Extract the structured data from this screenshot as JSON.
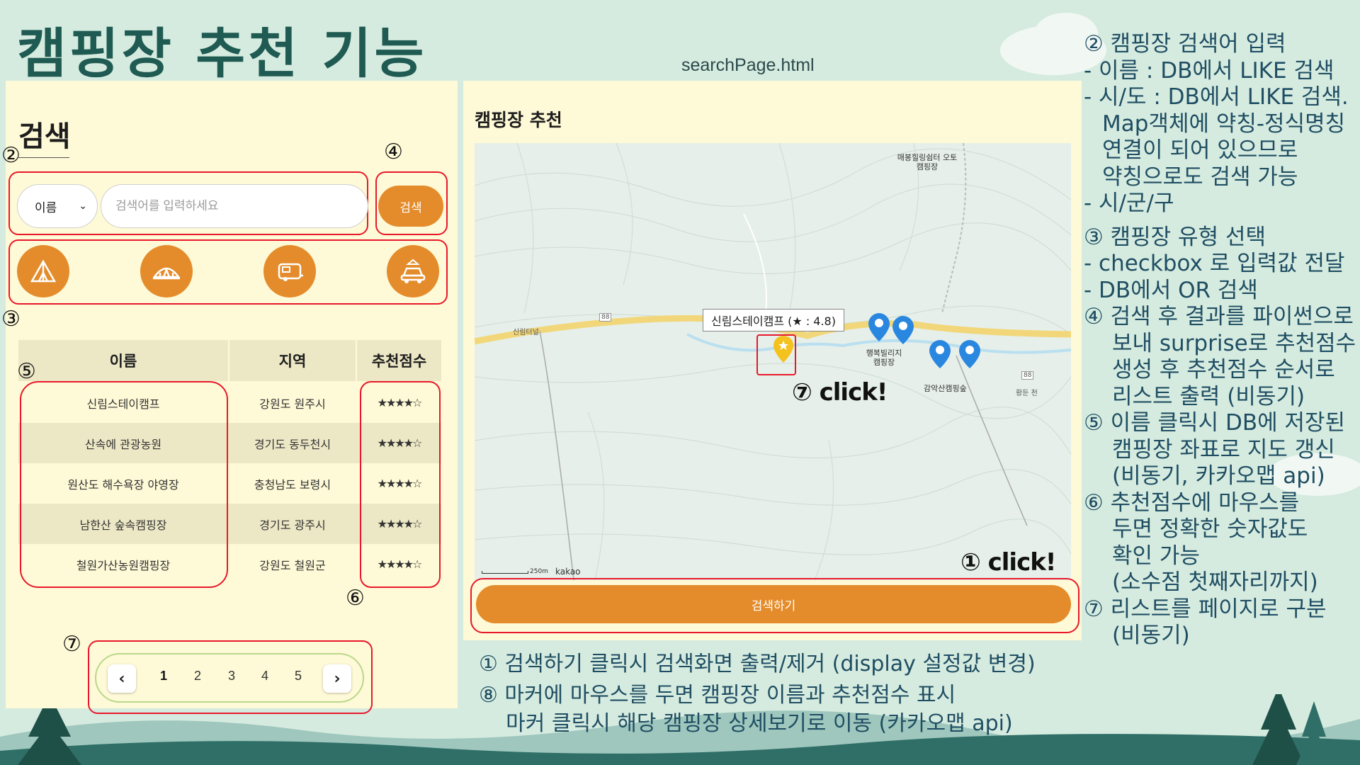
{
  "slide": {
    "title": "캠핑장 추천 기능",
    "file_name": "searchPage.html"
  },
  "search_panel": {
    "heading": "검색",
    "select_value": "이름",
    "input_placeholder": "검색어를 입력하세요",
    "search_button": "검색",
    "type_icons": [
      "tent-icon",
      "glamping-icon",
      "caravan-icon",
      "car-camping-icon"
    ],
    "table": {
      "headers": [
        "이름",
        "지역",
        "추천점수"
      ],
      "rows": [
        {
          "name": "신림스테이캠프",
          "region": "강원도 원주시",
          "stars": "★★★★☆"
        },
        {
          "name": "산속에 관광농원",
          "region": "경기도 동두천시",
          "stars": "★★★★☆"
        },
        {
          "name": "원산도 해수욕장 야영장",
          "region": "충청남도 보령시",
          "stars": "★★★★☆"
        },
        {
          "name": "남한산 숲속캠핑장",
          "region": "경기도 광주시",
          "stars": "★★★★☆"
        },
        {
          "name": "철원가산농원캠핑장",
          "region": "강원도 철원군",
          "stars": "★★★★☆"
        }
      ]
    },
    "pagination": {
      "prev": "‹",
      "next": "›",
      "pages": [
        "1",
        "2",
        "3",
        "4",
        "5"
      ],
      "current": "1"
    }
  },
  "recommend_panel": {
    "title": "캠핑장 추천",
    "map": {
      "tooltip": "신림스테이캠프 (★ : 4.8)",
      "labels": [
        "매봉힐링쉼터 오토캠핑장",
        "행복빌리지 캠핑장",
        "감악산캠핑숲",
        "신림터널",
        "88",
        "88",
        "황둔 천"
      ],
      "scale": "250m",
      "brand": "kakao"
    },
    "search_toggle_button": "검색하기"
  },
  "annotations": {
    "markers": [
      "②",
      "③",
      "④",
      "⑤",
      "⑥",
      "⑦",
      "①",
      "⑦"
    ],
    "click_map": "⑦ click!",
    "click_button": "① click!"
  },
  "notes_right": [
    "② 캠핑장 검색어 입력",
    "- 이름 : DB에서 LIKE 검색",
    "- 시/도 : DB에서 LIKE 검색.",
    "  Map객체에 약칭-정식명칭",
    "  연결이 되어 있으므로",
    "  약칭으로도 검색 가능",
    "- 시/군/구",
    "③ 캠핑장 유형 선택",
    "- checkbox 로 입력값 전달",
    "- DB에서 OR 검색",
    "④ 검색 후 결과를 파이썬으로",
    "   보내 surprise로 추천점수",
    "   생성 후 추천점수 순서로",
    "   리스트 출력 (비동기)",
    "⑤ 이름 클릭시 DB에 저장된",
    "   캠핑장 좌표로 지도 갱신",
    "   (비동기, 카카오맵 api)",
    "⑥ 추천점수에 마우스를",
    "   두면 정확한 숫자값도",
    "   확인 가능",
    "   (소수점 첫째자리까지)",
    "⑦ 리스트를 페이지로 구분",
    "   (비동기)"
  ],
  "notes_bottom": [
    "① 검색하기 클릭시 검색화면 출력/제거 (display 설정값 변경)",
    "⑧ 마커에 마우스를 두면 캠핑장 이름과 추천점수 표시",
    "    마커 클릭시 해당 캠핑장 상세보기로 이동 (카카오맵 api)"
  ],
  "colors": {
    "background": "#d6ebdf",
    "panel": "#fef9d6",
    "accent": "#e48c2b",
    "annotation": "#e8182c",
    "title": "#1f5b52",
    "note_text": "#1f4e63"
  }
}
